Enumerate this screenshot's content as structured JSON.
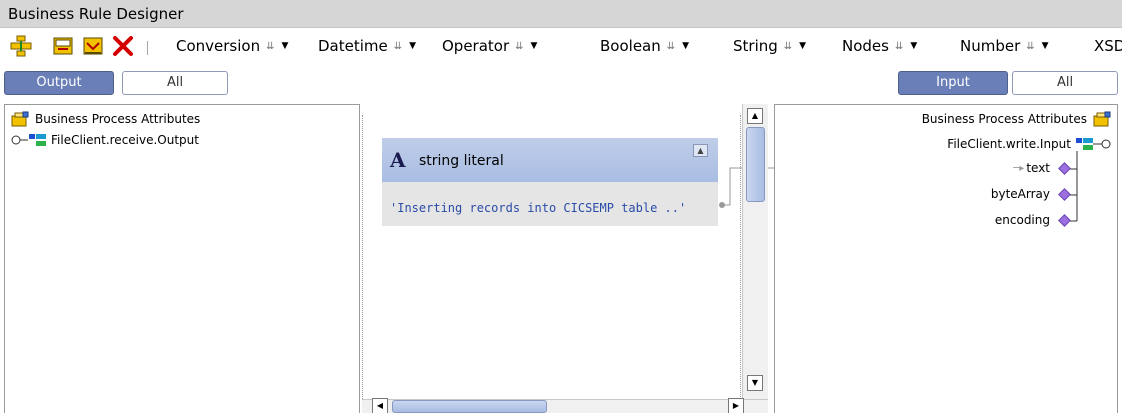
{
  "window": {
    "title": "Business Rule Designer"
  },
  "toolbar": {
    "icons": [
      "map-node-icon",
      "new-rule-icon",
      "edit-rule-icon",
      "delete-icon"
    ],
    "menus": [
      {
        "label": "Conversion"
      },
      {
        "label": "Datetime"
      },
      {
        "label": "Operator"
      },
      {
        "label": "Boolean"
      },
      {
        "label": "String"
      },
      {
        "label": "Nodes"
      },
      {
        "label": "Number"
      },
      {
        "label": "XSD"
      }
    ]
  },
  "left_panel": {
    "toggle": {
      "primary": "Output",
      "secondary": "All"
    },
    "root": "Business Process Attributes",
    "child": "FileClient.receive.Output"
  },
  "canvas": {
    "card": {
      "icon_letter": "A",
      "title": "string literal",
      "value": "'Inserting records into CICSEMP table ..'"
    }
  },
  "right_panel": {
    "toggle": {
      "primary": "Input",
      "secondary": "All"
    },
    "root": "Business Process Attributes",
    "child": "FileClient.write.Input",
    "fields": [
      {
        "label": "text"
      },
      {
        "label": "byteArray"
      },
      {
        "label": "encoding"
      }
    ]
  },
  "colors": {
    "accent": "#6a7fb8",
    "card_header": "#a9bde3",
    "field_diamond": "#9b6fe0",
    "literal_text": "#2a4ca8"
  }
}
